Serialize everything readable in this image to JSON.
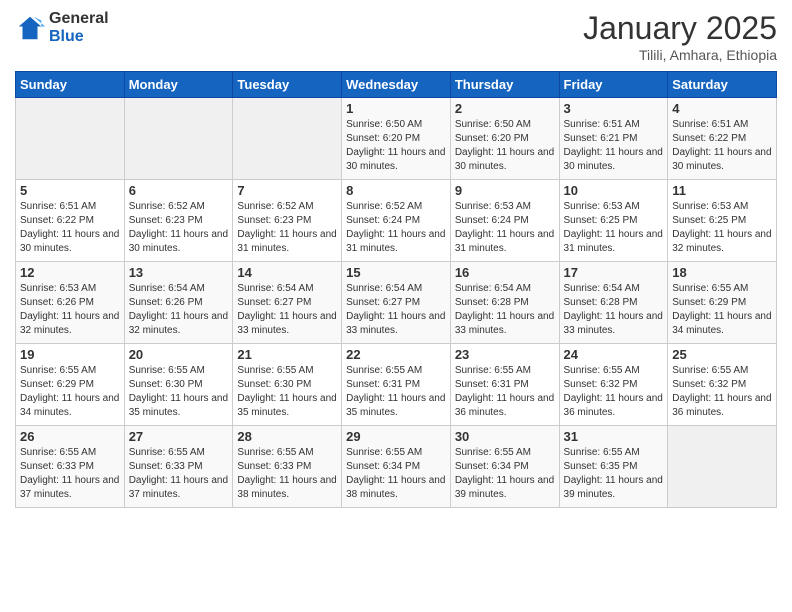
{
  "logo": {
    "general": "General",
    "blue": "Blue"
  },
  "header": {
    "month": "January 2025",
    "location": "Tilili, Amhara, Ethiopia"
  },
  "days_of_week": [
    "Sunday",
    "Monday",
    "Tuesday",
    "Wednesday",
    "Thursday",
    "Friday",
    "Saturday"
  ],
  "weeks": [
    [
      {
        "day": "",
        "info": ""
      },
      {
        "day": "",
        "info": ""
      },
      {
        "day": "",
        "info": ""
      },
      {
        "day": "1",
        "info": "Sunrise: 6:50 AM\nSunset: 6:20 PM\nDaylight: 11 hours and 30 minutes."
      },
      {
        "day": "2",
        "info": "Sunrise: 6:50 AM\nSunset: 6:20 PM\nDaylight: 11 hours and 30 minutes."
      },
      {
        "day": "3",
        "info": "Sunrise: 6:51 AM\nSunset: 6:21 PM\nDaylight: 11 hours and 30 minutes."
      },
      {
        "day": "4",
        "info": "Sunrise: 6:51 AM\nSunset: 6:22 PM\nDaylight: 11 hours and 30 minutes."
      }
    ],
    [
      {
        "day": "5",
        "info": "Sunrise: 6:51 AM\nSunset: 6:22 PM\nDaylight: 11 hours and 30 minutes."
      },
      {
        "day": "6",
        "info": "Sunrise: 6:52 AM\nSunset: 6:23 PM\nDaylight: 11 hours and 30 minutes."
      },
      {
        "day": "7",
        "info": "Sunrise: 6:52 AM\nSunset: 6:23 PM\nDaylight: 11 hours and 31 minutes."
      },
      {
        "day": "8",
        "info": "Sunrise: 6:52 AM\nSunset: 6:24 PM\nDaylight: 11 hours and 31 minutes."
      },
      {
        "day": "9",
        "info": "Sunrise: 6:53 AM\nSunset: 6:24 PM\nDaylight: 11 hours and 31 minutes."
      },
      {
        "day": "10",
        "info": "Sunrise: 6:53 AM\nSunset: 6:25 PM\nDaylight: 11 hours and 31 minutes."
      },
      {
        "day": "11",
        "info": "Sunrise: 6:53 AM\nSunset: 6:25 PM\nDaylight: 11 hours and 32 minutes."
      }
    ],
    [
      {
        "day": "12",
        "info": "Sunrise: 6:53 AM\nSunset: 6:26 PM\nDaylight: 11 hours and 32 minutes."
      },
      {
        "day": "13",
        "info": "Sunrise: 6:54 AM\nSunset: 6:26 PM\nDaylight: 11 hours and 32 minutes."
      },
      {
        "day": "14",
        "info": "Sunrise: 6:54 AM\nSunset: 6:27 PM\nDaylight: 11 hours and 33 minutes."
      },
      {
        "day": "15",
        "info": "Sunrise: 6:54 AM\nSunset: 6:27 PM\nDaylight: 11 hours and 33 minutes."
      },
      {
        "day": "16",
        "info": "Sunrise: 6:54 AM\nSunset: 6:28 PM\nDaylight: 11 hours and 33 minutes."
      },
      {
        "day": "17",
        "info": "Sunrise: 6:54 AM\nSunset: 6:28 PM\nDaylight: 11 hours and 33 minutes."
      },
      {
        "day": "18",
        "info": "Sunrise: 6:55 AM\nSunset: 6:29 PM\nDaylight: 11 hours and 34 minutes."
      }
    ],
    [
      {
        "day": "19",
        "info": "Sunrise: 6:55 AM\nSunset: 6:29 PM\nDaylight: 11 hours and 34 minutes."
      },
      {
        "day": "20",
        "info": "Sunrise: 6:55 AM\nSunset: 6:30 PM\nDaylight: 11 hours and 35 minutes."
      },
      {
        "day": "21",
        "info": "Sunrise: 6:55 AM\nSunset: 6:30 PM\nDaylight: 11 hours and 35 minutes."
      },
      {
        "day": "22",
        "info": "Sunrise: 6:55 AM\nSunset: 6:31 PM\nDaylight: 11 hours and 35 minutes."
      },
      {
        "day": "23",
        "info": "Sunrise: 6:55 AM\nSunset: 6:31 PM\nDaylight: 11 hours and 36 minutes."
      },
      {
        "day": "24",
        "info": "Sunrise: 6:55 AM\nSunset: 6:32 PM\nDaylight: 11 hours and 36 minutes."
      },
      {
        "day": "25",
        "info": "Sunrise: 6:55 AM\nSunset: 6:32 PM\nDaylight: 11 hours and 36 minutes."
      }
    ],
    [
      {
        "day": "26",
        "info": "Sunrise: 6:55 AM\nSunset: 6:33 PM\nDaylight: 11 hours and 37 minutes."
      },
      {
        "day": "27",
        "info": "Sunrise: 6:55 AM\nSunset: 6:33 PM\nDaylight: 11 hours and 37 minutes."
      },
      {
        "day": "28",
        "info": "Sunrise: 6:55 AM\nSunset: 6:33 PM\nDaylight: 11 hours and 38 minutes."
      },
      {
        "day": "29",
        "info": "Sunrise: 6:55 AM\nSunset: 6:34 PM\nDaylight: 11 hours and 38 minutes."
      },
      {
        "day": "30",
        "info": "Sunrise: 6:55 AM\nSunset: 6:34 PM\nDaylight: 11 hours and 39 minutes."
      },
      {
        "day": "31",
        "info": "Sunrise: 6:55 AM\nSunset: 6:35 PM\nDaylight: 11 hours and 39 minutes."
      },
      {
        "day": "",
        "info": ""
      }
    ]
  ]
}
